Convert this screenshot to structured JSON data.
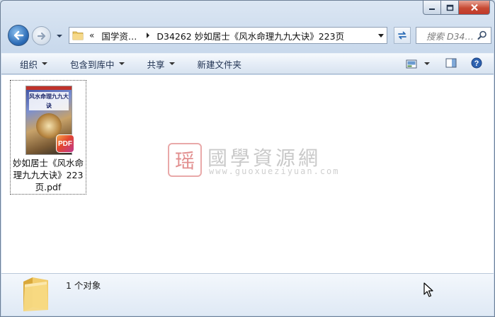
{
  "window": {
    "caption_buttons": [
      "minimize",
      "maximize",
      "close"
    ]
  },
  "navigation": {
    "back_icon": "back-arrow-icon",
    "forward_icon": "forward-arrow-icon",
    "history_icon": "chevron-down-icon"
  },
  "address_bar": {
    "overflow": "«",
    "segments": [
      "国学资…",
      "D34262 妙如居士《风水命理九九大诀》223页"
    ],
    "separator_icon": "breadcrumb-arrow-icon"
  },
  "search": {
    "placeholder": "搜索 D34…",
    "icon": "search-icon"
  },
  "toolbar": {
    "organize": "组织",
    "include_library": "包含到库中",
    "share": "共享",
    "new_folder": "新建文件夹",
    "right_icons": [
      "view-options-icon",
      "preview-pane-icon",
      "help-icon"
    ]
  },
  "files": [
    {
      "name": "妙如居士《风水命理九九大诀》223页.pdf",
      "thumb_title": "风水命理九九大诀",
      "badge": "PDF"
    }
  ],
  "watermark": {
    "seal": "瑶",
    "title": "國學資源網",
    "url": "www.guoxueziyuan.com"
  },
  "status": {
    "count": "1 个对象"
  },
  "colors": {
    "accent": "#2b6bb6",
    "close_button": "#c74a33",
    "command_text": "#1e3050"
  }
}
